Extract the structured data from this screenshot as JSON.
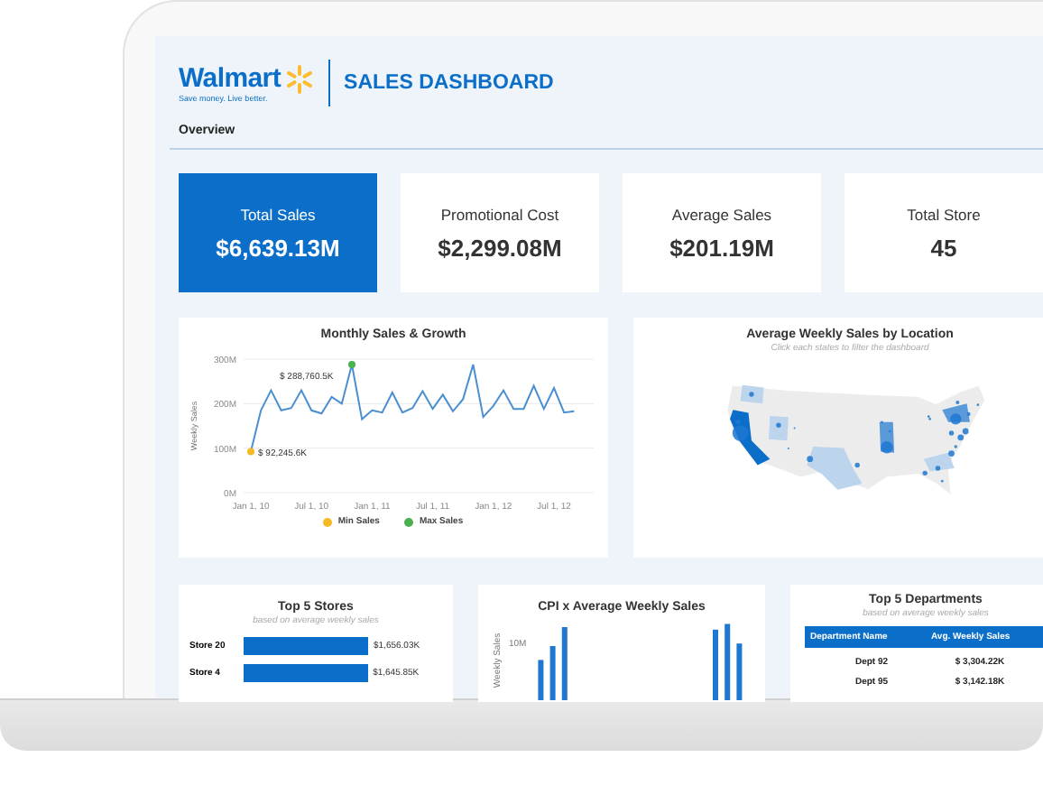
{
  "header": {
    "brand": "Walmart",
    "tagline": "Save money. Live better.",
    "title": "SALES DASHBOARD"
  },
  "tabs": [
    {
      "label": "Overview",
      "selected": true
    }
  ],
  "kpis": [
    {
      "label": "Total Sales",
      "value": "$6,639.13M",
      "selected": true
    },
    {
      "label": "Promotional Cost",
      "value": "$2,299.08M",
      "selected": false
    },
    {
      "label": "Average Sales",
      "value": "$201.19M",
      "selected": false
    },
    {
      "label": "Total Store",
      "value": "45",
      "selected": false
    }
  ],
  "monthly_sales": {
    "chart_data": {
      "type": "line",
      "title": "Monthly Sales & Growth",
      "ylabel": "Weekly Sales",
      "categories": [
        "Jan 1, 10",
        null,
        null,
        null,
        null,
        null,
        "Jul 1, 10",
        null,
        null,
        null,
        null,
        null,
        "Jan 1, 11",
        null,
        null,
        null,
        null,
        null,
        "Jul 1, 11",
        null,
        null,
        null,
        null,
        null,
        "Jan 1, 12",
        null,
        null,
        null,
        null,
        null,
        "Jul 1, 12",
        null,
        null
      ],
      "series": [
        {
          "color": "#4a8fd0",
          "values": [
            92,
            185,
            230,
            185,
            190,
            230,
            185,
            178,
            215,
            200,
            288,
            165,
            185,
            180,
            225,
            180,
            190,
            228,
            188,
            220,
            183,
            210,
            288,
            170,
            195,
            230,
            188,
            188,
            240,
            188,
            235,
            180,
            183
          ]
        }
      ],
      "ylim": [
        0,
        300
      ],
      "yticks": [
        {
          "value": 0,
          "label": "0M"
        },
        {
          "value": 100,
          "label": "100M"
        },
        {
          "value": 200,
          "label": "200M"
        },
        {
          "value": 300,
          "label": "300M"
        }
      ],
      "annotations": [
        {
          "text": "$ 92,245.6K"
        },
        {
          "text": "$ 288,760.5K"
        }
      ]
    },
    "legend": [
      {
        "label": "Min Sales",
        "color": "#f5b923"
      },
      {
        "label": "Max Sales",
        "color": "#4caf50"
      }
    ]
  },
  "map": {
    "title": "Average Weekly Sales by Location",
    "subtitle": "Click each states to filter the dashboard"
  },
  "top_stores": {
    "title": "Top 5 Stores",
    "subtitle": "based on average weekly sales",
    "chart_data": {
      "type": "bar",
      "orientation": "horizontal",
      "categories": [
        "Store 20",
        "Store 4"
      ],
      "values": [
        1656.03,
        1645.85
      ],
      "value_labels": [
        "$1,656.03K",
        "$1,645.85K"
      ]
    }
  },
  "cpi": {
    "title": "CPI x Average Weekly Sales",
    "ylabel": "Weekly Sales",
    "ytick": "10M"
  },
  "departments": {
    "title": "Top 5 Departments",
    "subtitle": "based on average weekly sales",
    "columns": [
      "Department Name",
      "Avg. Weekly Sales"
    ],
    "rows": [
      [
        "Dept 92",
        "$ 3,304.22K"
      ],
      [
        "Dept 95",
        "$ 3,142.18K"
      ]
    ]
  }
}
